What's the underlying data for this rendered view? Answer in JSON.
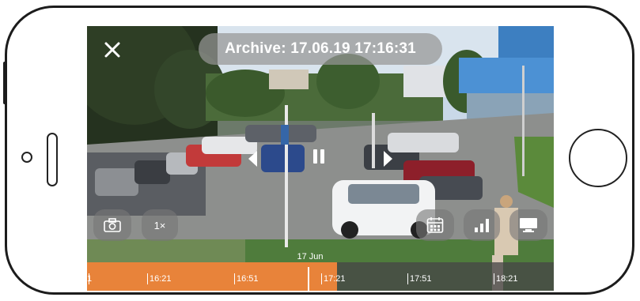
{
  "player": {
    "archive_label": "Archive: 17.06.19 17:16:31",
    "speed_label": "1×",
    "date_label": "17 Jun",
    "timeline_ticks": [
      "16:21",
      "16:51",
      "17:21",
      "17:51",
      "18:21"
    ],
    "timeline_leading_label": "1",
    "icons": {
      "close": "close-icon",
      "snapshot": "camera-icon",
      "calendar": "calendar-icon",
      "quality": "signal-bars-icon",
      "display": "monitor-icon",
      "pause": "pause-icon",
      "prev": "chevron-left-icon",
      "next": "chevron-right-icon"
    },
    "colors": {
      "recorded_segment": "#e8833a",
      "control_bg": "#787878"
    }
  }
}
